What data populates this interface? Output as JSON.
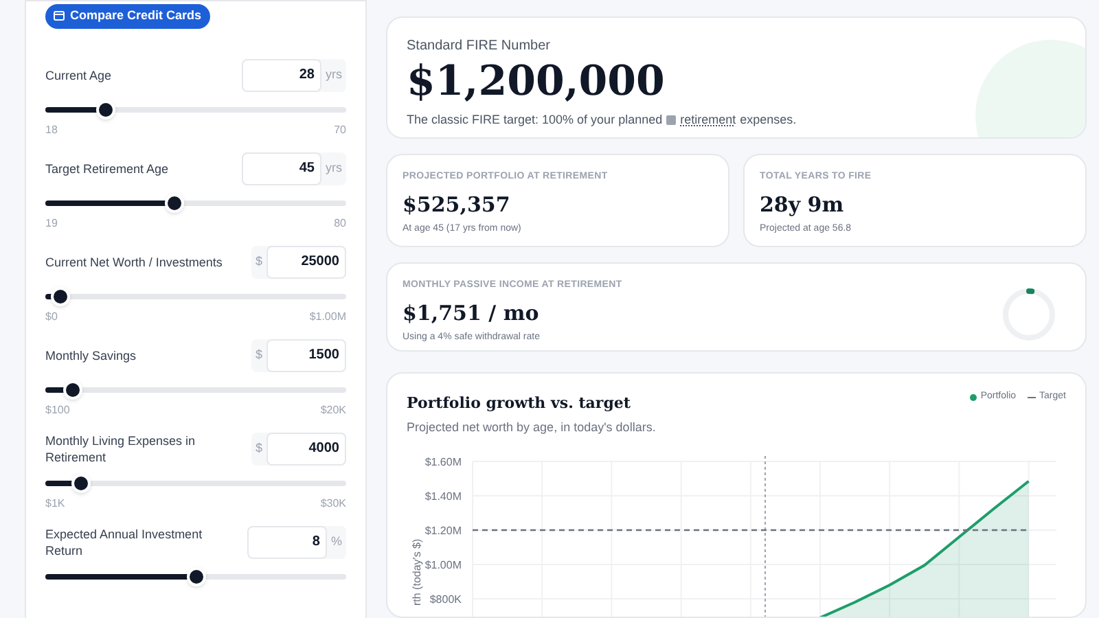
{
  "compare_button": {
    "label": "Compare Credit Cards"
  },
  "inputs": [
    {
      "label": "Current Age",
      "value": "28",
      "kind": "suffix",
      "unit": "yrs",
      "level": 0.2,
      "min": "18",
      "max": "70"
    },
    {
      "label": "Target Retirement Age",
      "value": "45",
      "kind": "suffix",
      "unit": "yrs",
      "level": 0.43,
      "min": "19",
      "max": "80"
    },
    {
      "label": "Current Net Worth / Investments",
      "value": "25000",
      "kind": "prefix",
      "unit": "$",
      "level": 0.05,
      "min": "$0",
      "max": "$1.00M"
    },
    {
      "label": "Monthly Savings",
      "value": "1500",
      "kind": "prefix",
      "unit": "$",
      "level": 0.09,
      "min": "$100",
      "max": "$20K"
    },
    {
      "label": "Monthly Living Expenses in Retirement",
      "value": "4000",
      "kind": "prefix",
      "unit": "$",
      "level": 0.12,
      "min": "$1K",
      "max": "$30K"
    },
    {
      "label": "Expected Annual Investment Return",
      "value": "8",
      "kind": "suffix",
      "unit": "%",
      "level": 0.5
    }
  ],
  "fire_card": {
    "label": "Standard FIRE Number",
    "value": "$1,200,000",
    "text_before": "The classic FIRE target: 100% of your planned",
    "link": "retirement",
    "text_after": "expenses."
  },
  "stats": [
    {
      "label": "PROJECTED PORTFOLIO AT RETIREMENT",
      "value": "$525,357",
      "note": "At age 45 (17 yrs from now)"
    },
    {
      "label": "TOTAL YEARS TO FIRE",
      "value": "28y 9m",
      "note": "Projected at age 56.8"
    }
  ],
  "income_card": {
    "label": "MONTHLY PASSIVE INCOME AT RETIREMENT",
    "value": "$1,751 / mo",
    "note": "Using a 4% safe withdrawal rate",
    "level": 0.02
  },
  "chart_card": {
    "title": "Portfolio growth vs. target",
    "subtitle": "Projected net worth by age, in today's dollars.",
    "chart_data": {
      "type": "area",
      "ylabel": "rth (today's $)",
      "grid": true,
      "ylim": [
        680000,
        1600000
      ],
      "categories": [
        null,
        null,
        null,
        null,
        null,
        null,
        null,
        null,
        null,
        null,
        null,
        null,
        null,
        null,
        null,
        null,
        null
      ],
      "yticks": [
        {
          "value": 800000,
          "label": "$800K"
        },
        {
          "value": 1000000,
          "label": "$1.00M"
        },
        {
          "value": 1200000,
          "label": "$1.20M"
        },
        {
          "value": 1400000,
          "label": "$1.40M"
        },
        {
          "value": 1600000,
          "label": "$1.60M"
        }
      ],
      "series": [
        {
          "name": "Portfolio",
          "color": "#1f9d6b",
          "values": [
            null,
            null,
            null,
            null,
            null,
            null,
            null,
            null,
            null,
            null,
            690000,
            780000,
            880000,
            995000,
            1160000,
            1325000,
            1485000
          ]
        },
        {
          "name": "Target",
          "color": "#6b7280",
          "type": "line",
          "line_style": "dashed",
          "values": [
            1200000,
            1200000,
            1200000,
            1200000,
            1200000,
            1200000,
            1200000,
            1200000,
            1200000,
            1200000,
            1200000,
            1200000,
            1200000,
            1200000,
            1200000,
            1200000,
            1200000
          ]
        }
      ]
    }
  }
}
